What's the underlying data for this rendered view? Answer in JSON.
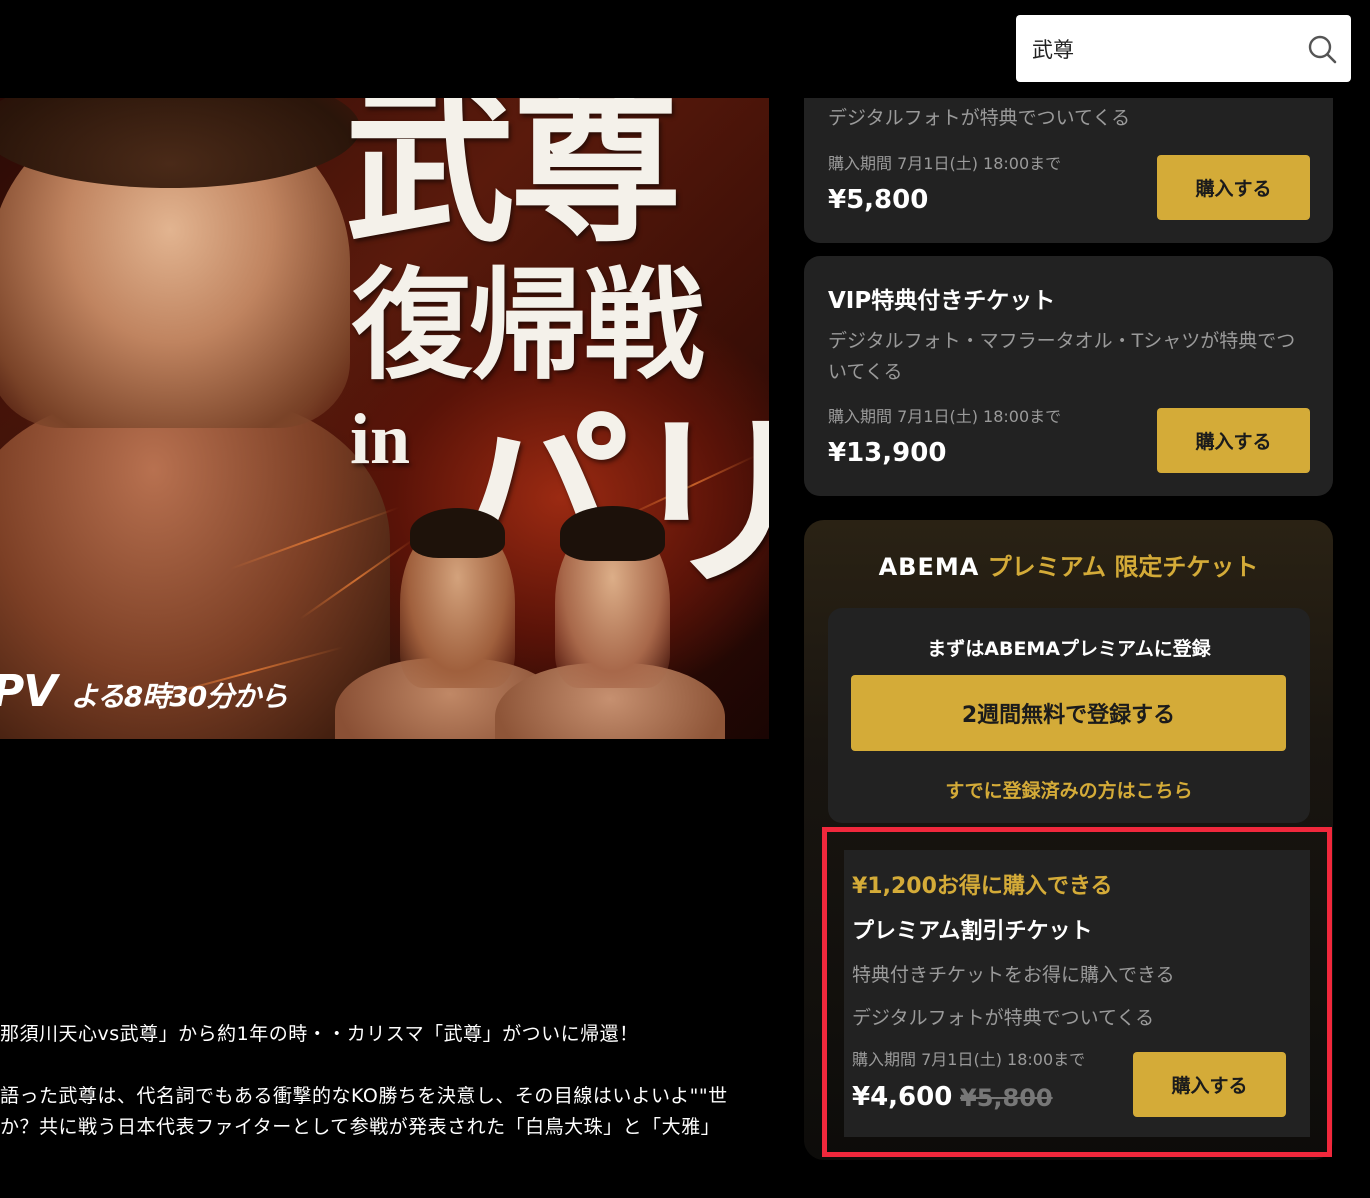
{
  "search": {
    "value": "武尊"
  },
  "hero": {
    "title_line1": "武尊",
    "title_line2": "復帰戦",
    "title_in": "in",
    "title_line3": "パリ",
    "ppv_text": "PV",
    "ppv_time": "よる8時30分から"
  },
  "description": {
    "line1": "那須川天心vs武尊」から約1年の時・・カリスマ「武尊」がついに帰還！",
    "line2": "語った武尊は、代名詞でもある衝撃的なKO勝ちを決意し、その目線はいよいよ\"\"世",
    "line3": "か？共に戦う日本代表ファイターとして参戦が発表された「白鳥大珠」と「大雅」"
  },
  "tickets": [
    {
      "bonus": "デジタルフォトが特典でついてくる",
      "period": "購入期間 7月1日(土) 18:00まで",
      "price": "¥5,800",
      "button": "購入する"
    },
    {
      "name": "VIP特典付きチケット",
      "bonus": "デジタルフォト・マフラータオル・Tシャツが特典でついてくる",
      "period": "購入期間 7月1日(土) 18:00まで",
      "price": "¥13,900",
      "button": "購入する"
    }
  ],
  "premium": {
    "brand": "ABEMA",
    "title_gold": "プレミアム",
    "title_suffix": "限定チケット",
    "register_heading": "まずはABEMAプレミアムに登録",
    "register_button": "2週間無料で登録する",
    "login_link": "すでに登録済みの方はこちら"
  },
  "discount_ticket": {
    "saving": "¥1,200お得に購入できる",
    "name": "プレミアム割引チケット",
    "line1": "特典付きチケットをお得に購入できる",
    "line2": "デジタルフォトが特典でついてくる",
    "period": "購入期間 7月1日(土) 18:00まで",
    "price": "¥4,600",
    "original_price": "¥5,800",
    "button": "購入する"
  },
  "colors": {
    "gold": "#d4ab38",
    "highlight_border": "#f0283c",
    "card_bg": "#222222"
  }
}
